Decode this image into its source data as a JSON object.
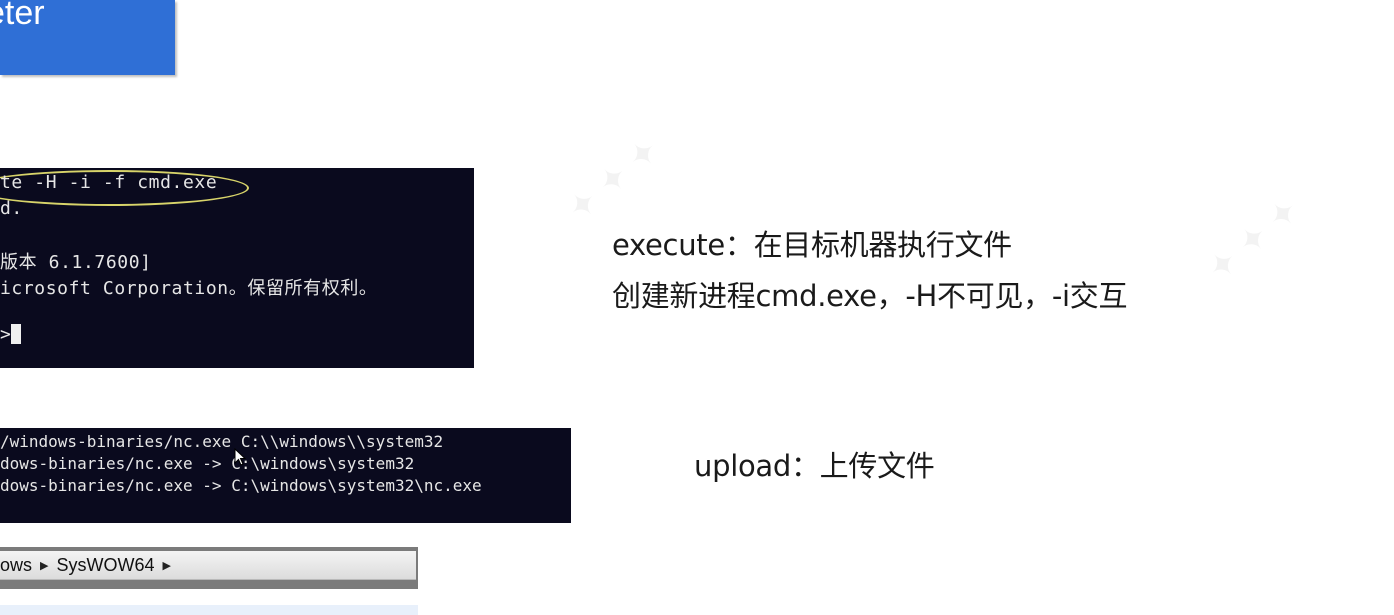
{
  "header": {
    "title_fragment": "eter"
  },
  "terminal_execute": {
    "lines": [
      "te -H -i -f cmd.exe",
      "d.",
      "",
      "版本 6.1.7600]",
      "icrosoft Corporation。保留所有权利。",
      "",
      ">"
    ]
  },
  "terminal_upload": {
    "lines": [
      "/windows-binaries/nc.exe C:\\\\windows\\\\system32",
      "dows-binaries/nc.exe -> C:\\windows\\system32",
      "dows-binaries/nc.exe -> C:\\windows\\system32\\nc.exe"
    ]
  },
  "explorer": {
    "crumbs": [
      "ows",
      "SysWOW64"
    ]
  },
  "notes": {
    "execute_title": "execute：在目标机器执行文件",
    "execute_detail": "创建新进程cmd.exe，-H不可见，-i交互",
    "upload_title": "upload：上传文件"
  },
  "colors": {
    "title_bg": "#2f6fd6",
    "terminal_bg": "#0a0a1e",
    "highlight": "#d8d46a"
  },
  "icons": {
    "breadcrumb_separator": "triangle-right-icon",
    "mouse": "mouse-pointer-icon"
  }
}
